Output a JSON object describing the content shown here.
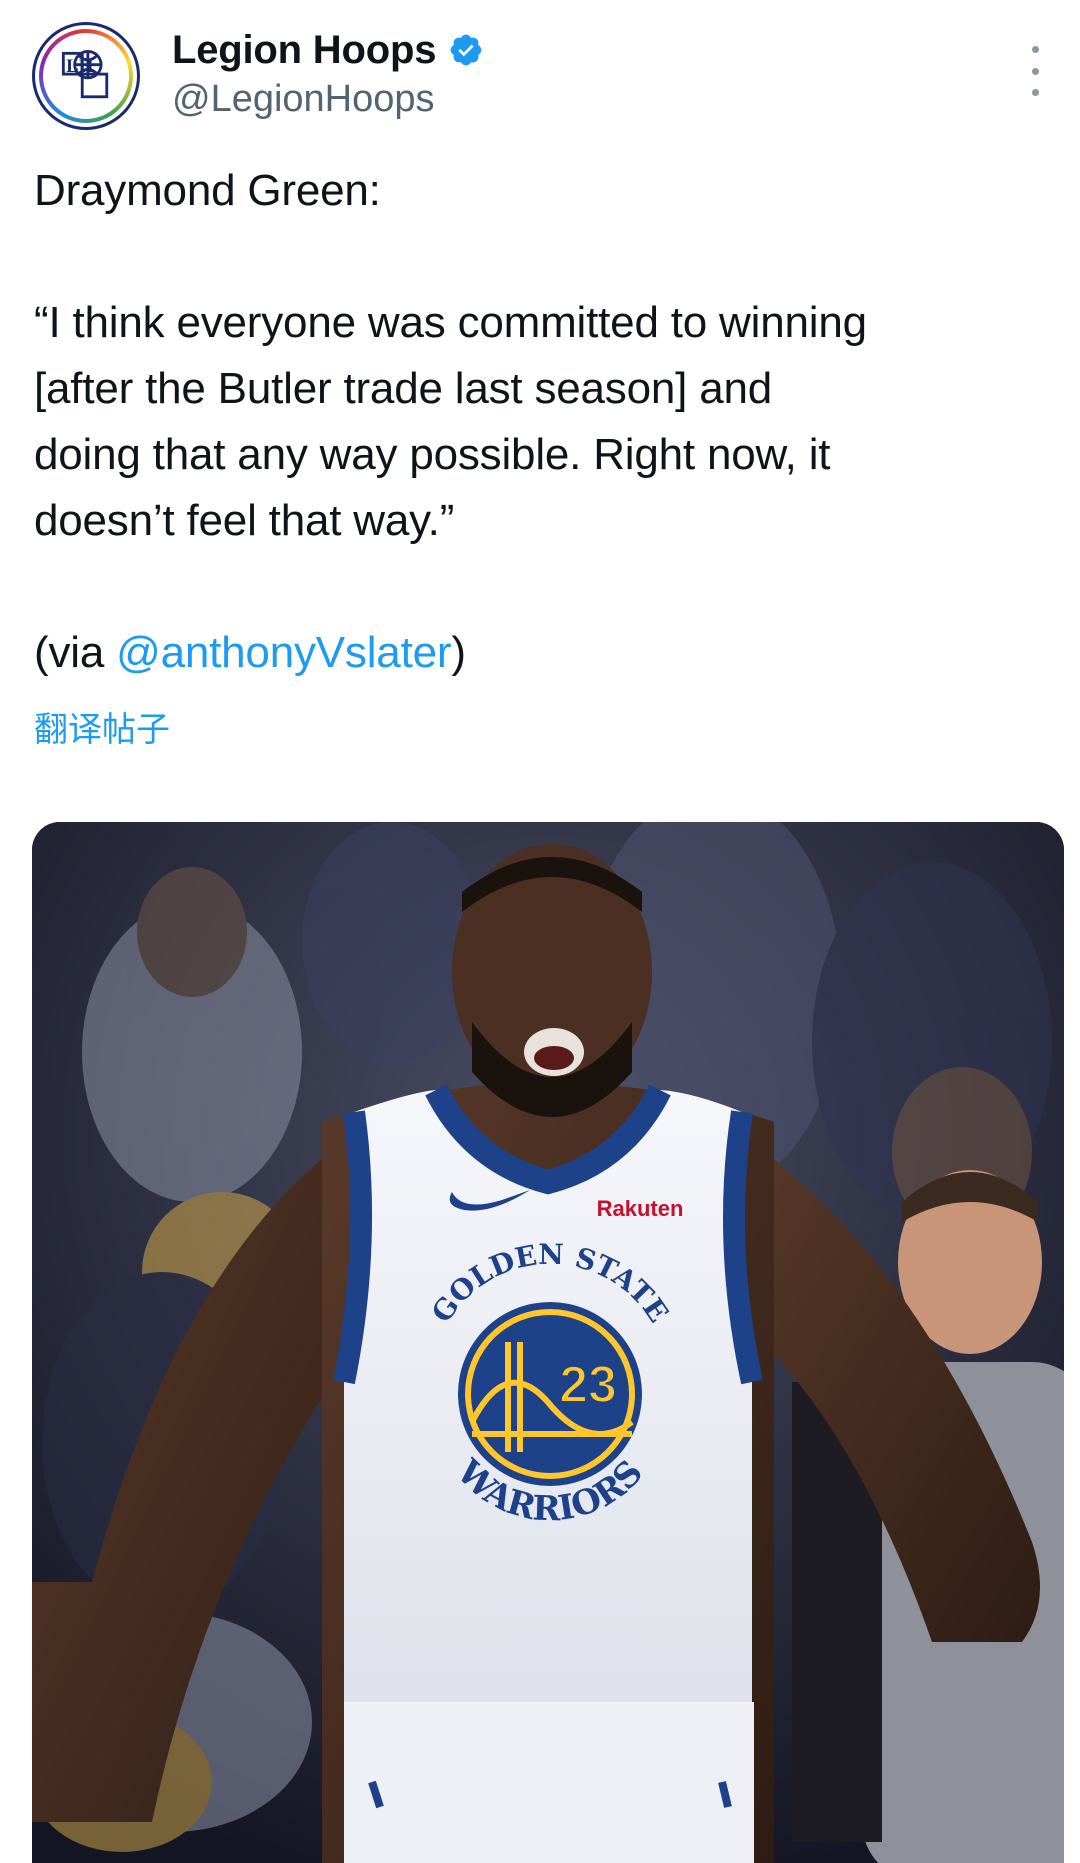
{
  "author": {
    "display_name": "Legion Hoops",
    "handle": "@LegionHoops",
    "avatar_text": "LH",
    "verified_icon": "verified-badge-icon"
  },
  "tweet": {
    "line_intro": "Draymond Green:",
    "quote_1": "“I think everyone was committed to winning",
    "quote_2": "[after the Butler trade last season] and",
    "quote_3": "doing that any way possible. Right now, it",
    "quote_4": "doesn’t feel that way.”",
    "via_prefix": "(via ",
    "via_mention": "@anthonyVslater",
    "via_suffix": ")",
    "translate_label": "翻译帖子"
  },
  "media": {
    "jersey_sponsor": "Rakuten",
    "jersey_top": "GOLDEN STATE",
    "jersey_bottom": "WARRIORS",
    "jersey_number": "23"
  },
  "colors": {
    "link": "#1d9bf0",
    "text": "#0f1419",
    "secondary": "#536471",
    "warriors_blue": "#1d428a",
    "warriors_gold": "#ffc72c"
  }
}
